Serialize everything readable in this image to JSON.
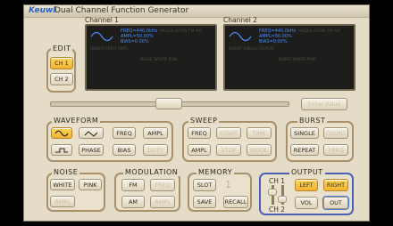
{
  "app": {
    "brand": "Keuwl",
    "title": "Dual Channel Function Generator"
  },
  "channels": [
    {
      "label": "Channel 1",
      "freq": "FREQ=440.0kHz",
      "ampl": "AMPL=50.00%",
      "bias": "BIAS=0.00%",
      "dim1": "MODULATION  FM  AM",
      "dim2": "SWEEP   FREQ  AMPL",
      "dim3": "NOISE  WHITE  PINK"
    },
    {
      "label": "Channel 2",
      "freq": "FREQ=440.0kHz",
      "ampl": "AMPL=50.00%",
      "bias": "BIAS=0.00%",
      "dim1": "MODULATION  FM  AM",
      "dim2": "BURST  SINGLE  REPEAT",
      "dim3": "NOISE  WHITE  PINK"
    }
  ],
  "edit": {
    "title": "EDIT",
    "ch1": "CH 1",
    "ch2": "CH 2"
  },
  "value_entry": {
    "label": "Enter Value"
  },
  "waveform": {
    "title": "WAVEFORM",
    "freq": "FREQ",
    "ampl": "AMPL",
    "phase": "PHASE",
    "bias": "BIAS",
    "duty": "DUTY",
    "icons": [
      "sine-wave-icon",
      "triangle-wave-icon",
      "square-wave-icon"
    ]
  },
  "sweep": {
    "title": "SWEEP",
    "freq": "FREQ",
    "start": "START",
    "time": "TIME",
    "ampl": "AMPL",
    "stop": "STOP",
    "mode": "MODE"
  },
  "burst": {
    "title": "BURST",
    "single": "SINGLE",
    "count": "COUNT",
    "repeat": "REPEAT",
    "freq": "FREQ"
  },
  "noise": {
    "title": "NOISE",
    "white": "WHITE",
    "pink": "PINK",
    "ampl": "AMPL"
  },
  "modulation": {
    "title": "MODULATION",
    "fm": "FM",
    "freq": "FREQ",
    "am": "AM",
    "ampl": "AMPL"
  },
  "memory": {
    "title": "MEMORY",
    "slot": "SLOT",
    "slot_num": "1",
    "save": "SAVE",
    "recall": "RECALL"
  },
  "output": {
    "title": "OUTPUT",
    "ch1": "CH 1",
    "ch2": "CH 2",
    "left": "LEFT",
    "right": "RIGHT",
    "vol": "VOL",
    "out": "OUT"
  },
  "colors": {
    "accent_on": "#f2b431",
    "screen_text": "#4a8cff",
    "panel": "#e4dcc6",
    "group_border": "#a7906a"
  }
}
